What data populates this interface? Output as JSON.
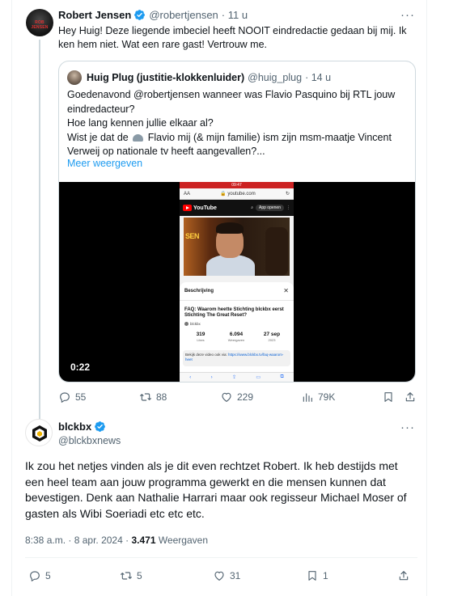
{
  "reply": {
    "name": "Robert Jensen",
    "handle": "@robertjensen",
    "time": "· 11 u",
    "avatar_text": "ROB JENSEN",
    "text": "Hey Huig! Deze liegende imbeciel heeft NOOIT eindredactie gedaan bij mij. Ik ken hem niet. Wat een rare gast! Vertrouw me.",
    "quote": {
      "name": "Huig Plug (justitie-klokkenluider)",
      "handle": "@huig_plug",
      "time": "· 14 u",
      "line1": "Goedenavond @robertjensen wanneer was Flavio Pasquino bij RTL jouw eindredacteur?",
      "line2": "Hoe lang kennen jullie elkaar al?",
      "line3_pre": "Wist je dat de",
      "line3_post": "Flavio mij (& mijn familie) ism zijn msm-maatje Vincent Verweij op nationale tv heeft aangevallen?...",
      "show_more": "Meer weergeven",
      "video_time": "0:22",
      "phone": {
        "status_time": "09:47",
        "aa": "AA",
        "url": "youtube.com",
        "yt_logo": "YouTube",
        "open_app": "App openen",
        "overlay": "SEN",
        "panel_title": "Beschrijving",
        "video_title": "FAQ: Waarom heette Stichting blckbx eerst Stichting The Great Reset?",
        "channel": "blckbx",
        "stats": [
          {
            "value": "319",
            "label": "Likes"
          },
          {
            "value": "6.094",
            "label": "Weergaven"
          },
          {
            "value": "27 sep",
            "label": "2023"
          }
        ],
        "box_text": "Bekijk deze video ook via:",
        "box_link": "https://www.blckbx.tv/faq-waarom-heet"
      }
    },
    "actions": {
      "replies": "55",
      "reposts": "88",
      "likes": "229",
      "views": "79K"
    }
  },
  "main": {
    "name": "blckbx",
    "handle": "@blckbxnews",
    "text": "Ik zou het netjes vinden als je dit even rechtzet Robert. Ik heb destijds met een heel team aan jouw programma gewerkt en die mensen kunnen dat bevestigen. Denk aan Nathalie Harrari maar ook regisseur Michael Moser of gasten als Wibi Soeriadi etc etc etc.",
    "time": "8:38 a.m.",
    "date": "8 apr. 2024",
    "views": "3.471",
    "views_label": "Weergaven",
    "actions": {
      "replies": "5",
      "reposts": "5",
      "likes": "31",
      "bookmarks": "1"
    }
  },
  "colors": {
    "accent": "#1d9bf0",
    "muted": "#536471",
    "text": "#0f1419",
    "border": "#cfd9de"
  }
}
